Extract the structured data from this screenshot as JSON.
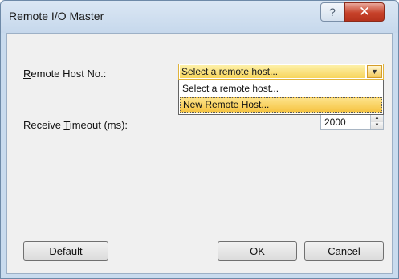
{
  "window": {
    "title": "Remote I/O Master",
    "help_glyph": "?",
    "close_glyph": "✕"
  },
  "form": {
    "remote_host_label_first": "R",
    "remote_host_label_rest": "emote Host No.:",
    "remote_host_value": "Select a remote host...",
    "remote_host_options": [
      "Select a remote host...",
      "New Remote Host..."
    ],
    "remote_host_highlighted_option": "New Remote Host...",
    "timeout_label_pre": "Receive ",
    "timeout_label_accel": "T",
    "timeout_label_post": "imeout (ms):",
    "timeout_value": "2000"
  },
  "buttons": {
    "default_accel": "D",
    "default_rest": "efault",
    "ok": "OK",
    "cancel": "Cancel"
  },
  "colors": {
    "selection_yellow": "#f7d55c",
    "close_red": "#c7422a"
  }
}
